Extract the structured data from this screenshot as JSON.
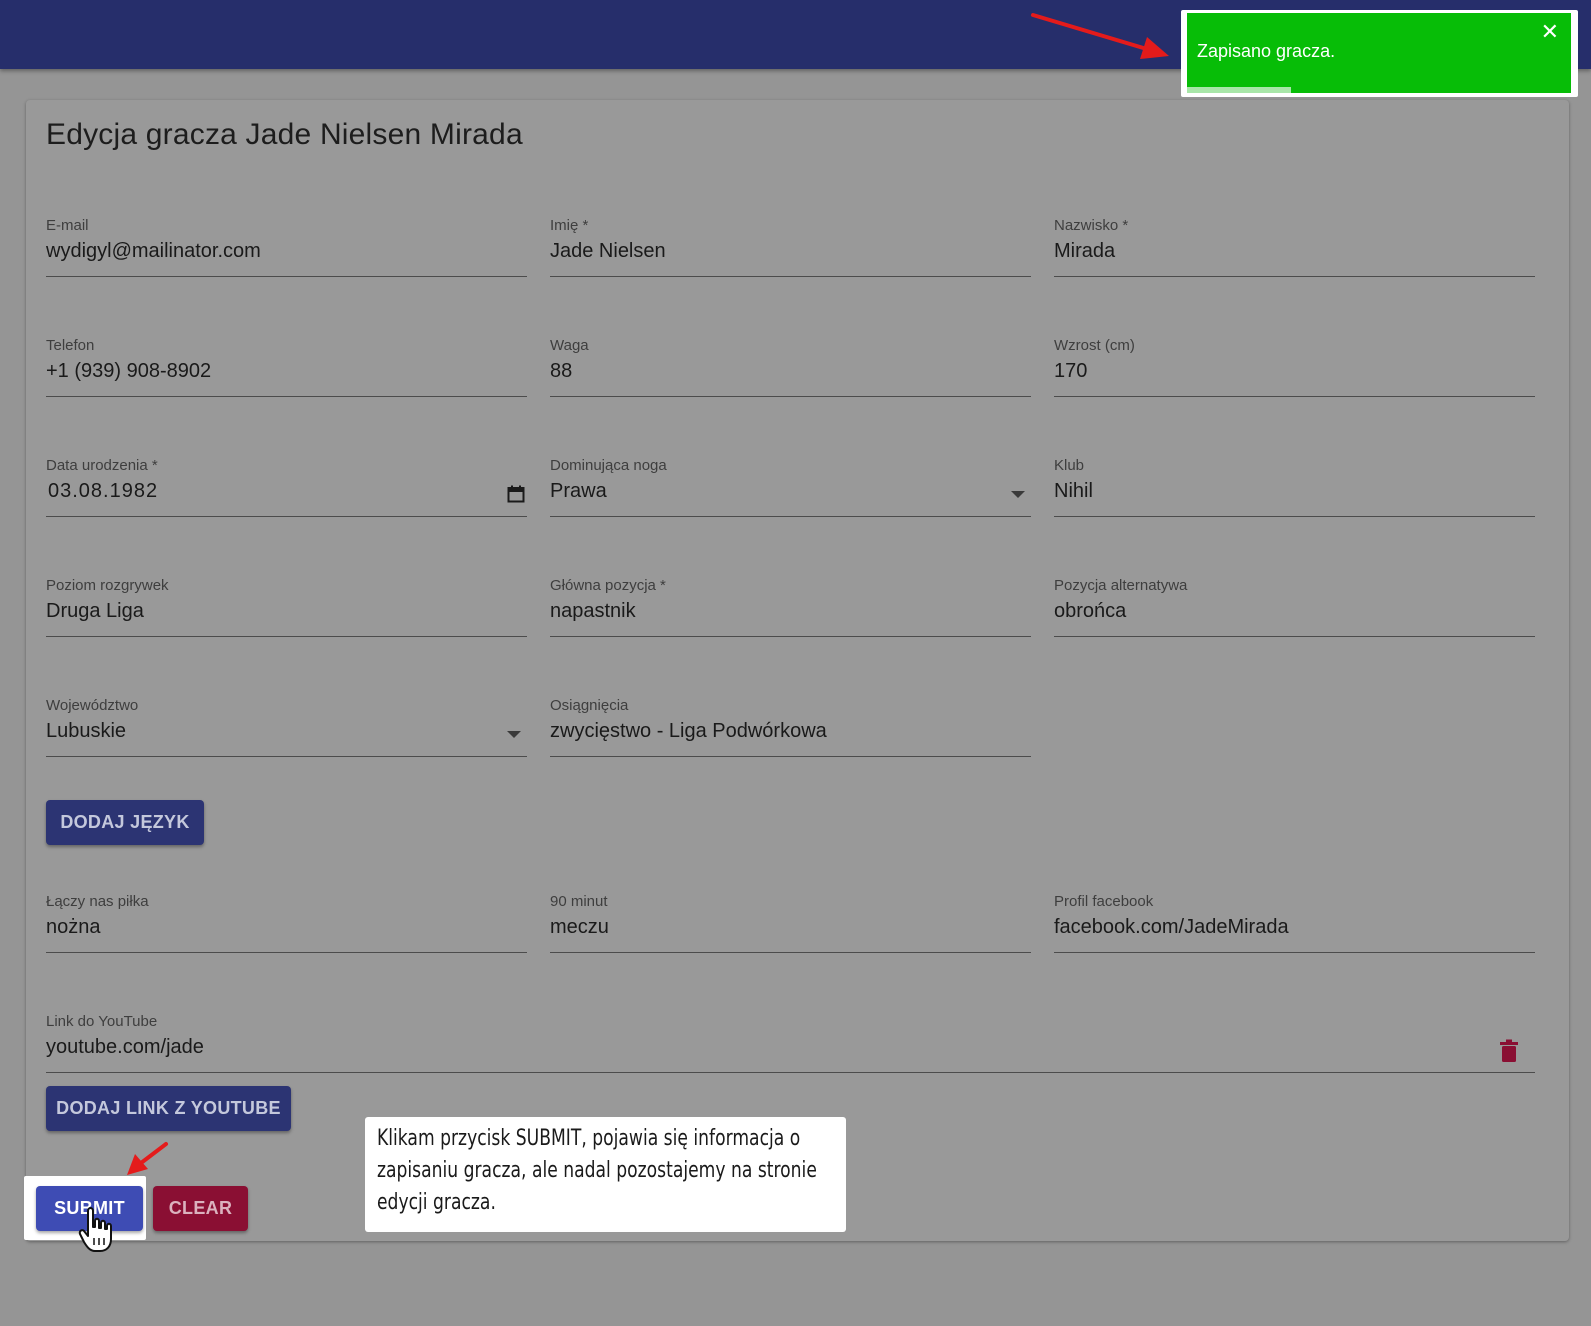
{
  "page": {
    "title": "Edycja gracza Jade Nielsen Mirada"
  },
  "toast": {
    "message": "Zapisano gracza.",
    "close_glyph": "✕",
    "progress_fraction": 0.27,
    "background_color": "#07bd07"
  },
  "fields": {
    "email": {
      "label": "E-mail",
      "value": "wydigyl@mailinator.com"
    },
    "first_name": {
      "label": "Imię *",
      "value": "Jade Nielsen"
    },
    "last_name": {
      "label": "Nazwisko *",
      "value": "Mirada"
    },
    "phone": {
      "label": "Telefon",
      "value": "+1 (939) 908-8902"
    },
    "weight": {
      "label": "Waga",
      "value": "88"
    },
    "height": {
      "label": "Wzrost (cm)",
      "value": "170"
    },
    "birth_date": {
      "label": "Data urodzenia *",
      "value": "03.08.1982",
      "icon": "calendar-icon"
    },
    "dominant_foot": {
      "label": "Dominująca noga",
      "value": "Prawa",
      "icon": "dropdown-arrow-icon"
    },
    "club": {
      "label": "Klub",
      "value": "Nihil"
    },
    "league_level": {
      "label": "Poziom rozgrywek",
      "value": "Druga Liga"
    },
    "main_position": {
      "label": "Główna pozycja *",
      "value": "napastnik"
    },
    "alt_position": {
      "label": "Pozycja alternatywa",
      "value": "obrońca"
    },
    "voivodeship": {
      "label": "Województwo",
      "value": "Lubuskie",
      "icon": "dropdown-arrow-icon"
    },
    "achievements": {
      "label": "Osiągnięcia",
      "value": "zwycięstwo - Liga Podwórkowa"
    },
    "laczy_nas_pilka": {
      "label": "Łączy nas piłka",
      "value": "nożna"
    },
    "ninety_minutes": {
      "label": "90 minut",
      "value": "meczu"
    },
    "facebook": {
      "label": "Profil facebook",
      "value": "facebook.com/JadeMirada"
    },
    "youtube": {
      "label": "Link do YouTube",
      "value": "youtube.com/jade",
      "icon": "trash-icon"
    }
  },
  "buttons": {
    "add_language": "DODAJ JĘZYK",
    "add_youtube": "DODAJ LINK Z YOUTUBE",
    "submit": "SUBMIT",
    "clear": "CLEAR"
  },
  "annotation": {
    "text": "Klikam przycisk SUBMIT, pojawia się informacja o zapisaniu gracza, ale nadal pozostajemy na stronie edycji gracza.",
    "arrow_color": "#e41b1b",
    "cursor_icon": "hand-pointer-icon"
  },
  "colors": {
    "topbar": "#262e6b",
    "primary_button": "#2c3473",
    "submit_button": "#3e4cb4",
    "danger_button": "#8a0f33",
    "trash_icon": "#8a0f33"
  }
}
